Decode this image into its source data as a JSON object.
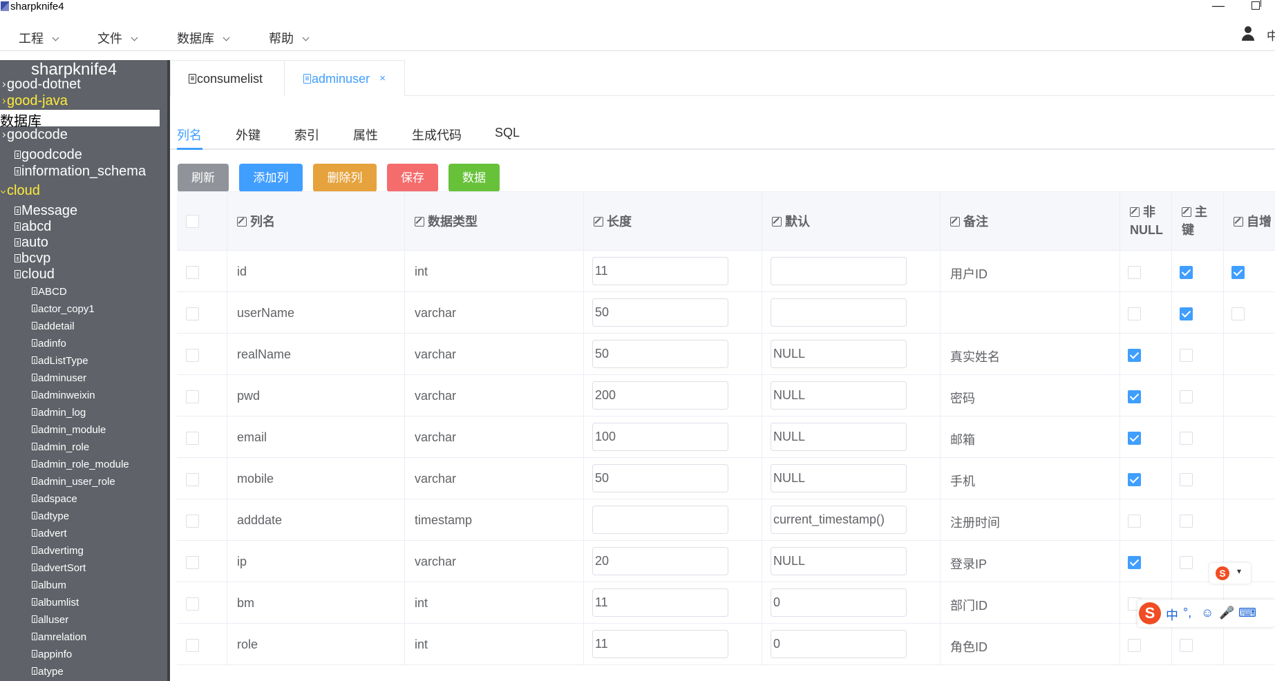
{
  "window": {
    "title": "sharpknife4"
  },
  "menu": [
    {
      "label": "工程"
    },
    {
      "label": "文件"
    },
    {
      "label": "数据库"
    },
    {
      "label": "帮助"
    }
  ],
  "topright": {
    "lang": "中"
  },
  "sidebar": {
    "root": "sharpknife4",
    "items": [
      {
        "label": "good-dotnet"
      },
      {
        "label": "good-java"
      },
      {
        "label": "数据库"
      },
      {
        "label": "goodcode"
      },
      {
        "label": "goodcode"
      },
      {
        "label": "information_schema"
      },
      {
        "label": "cloud"
      },
      {
        "label": "Message"
      },
      {
        "label": "abcd"
      },
      {
        "label": "auto"
      },
      {
        "label": "bcvp"
      },
      {
        "label": "cloud"
      }
    ],
    "tables": [
      "ABCD",
      "actor_copy1",
      "addetail",
      "adinfo",
      "adListType",
      "adminuser",
      "adminweixin",
      "admin_log",
      "admin_module",
      "admin_role",
      "admin_role_module",
      "admin_user_role",
      "adspace",
      "adtype",
      "advert",
      "advertimg",
      "advertSort",
      "album",
      "albumlist",
      "alluser",
      "amrelation",
      "appinfo",
      "atype"
    ]
  },
  "tabs": [
    {
      "label": "consumelist"
    },
    {
      "label": "adminuser",
      "close": "×"
    }
  ],
  "subtabs": [
    "列名",
    "外键",
    "索引",
    "属性",
    "生成代码",
    "SQL"
  ],
  "buttons": [
    {
      "label": "刷新",
      "color": "#909399"
    },
    {
      "label": "添加列",
      "color": "#409eff"
    },
    {
      "label": "删除列",
      "color": "#e6a23c"
    },
    {
      "label": "保存",
      "color": "#f56c6c"
    },
    {
      "label": "数据",
      "color": "#67c23a"
    }
  ],
  "table": {
    "headers": [
      "列名",
      "数据类型",
      "长度",
      "默认",
      "备注",
      "非NULL",
      "主键",
      "自增"
    ],
    "rows": [
      {
        "name": "id",
        "type": "int",
        "length": "11",
        "default": "",
        "comment": "用户ID",
        "notnull": false,
        "pk": true,
        "ai": true
      },
      {
        "name": "userName",
        "type": "varchar",
        "length": "50",
        "default": "",
        "comment": "",
        "notnull": false,
        "pk": true,
        "ai": false
      },
      {
        "name": "realName",
        "type": "varchar",
        "length": "50",
        "default": "NULL",
        "comment": "真实姓名",
        "notnull": true,
        "pk": false,
        "ai": null
      },
      {
        "name": "pwd",
        "type": "varchar",
        "length": "200",
        "default": "NULL",
        "comment": "密码",
        "notnull": true,
        "pk": false,
        "ai": null
      },
      {
        "name": "email",
        "type": "varchar",
        "length": "100",
        "default": "NULL",
        "comment": "邮箱",
        "notnull": true,
        "pk": false,
        "ai": null
      },
      {
        "name": "mobile",
        "type": "varchar",
        "length": "50",
        "default": "NULL",
        "comment": "手机",
        "notnull": true,
        "pk": false,
        "ai": null
      },
      {
        "name": "adddate",
        "type": "timestamp",
        "length": "",
        "default": "current_timestamp()",
        "comment": "注册时间",
        "notnull": false,
        "pk": false,
        "ai": null
      },
      {
        "name": "ip",
        "type": "varchar",
        "length": "20",
        "default": "NULL",
        "comment": "登录IP",
        "notnull": true,
        "pk": false,
        "ai": null
      },
      {
        "name": "bm",
        "type": "int",
        "length": "11",
        "default": "0",
        "comment": "部门ID",
        "notnull": false,
        "pk": null,
        "ai": null
      },
      {
        "name": "role",
        "type": "int",
        "length": "11",
        "default": "0",
        "comment": "角色ID",
        "notnull": false,
        "pk": false,
        "ai": null
      }
    ]
  },
  "ime": {
    "logo": "S",
    "mode": "中",
    "punct": "°,"
  }
}
